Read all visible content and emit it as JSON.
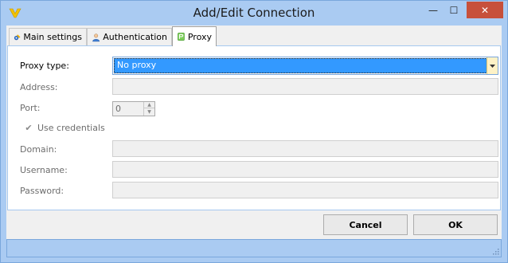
{
  "window": {
    "title": "Add/Edit Connection",
    "icon": "app-logo-icon",
    "controls": {
      "minimize": "—",
      "maximize": "☐",
      "close": "✕"
    }
  },
  "tabs": [
    {
      "label": "Main settings",
      "icon": "main-settings-icon"
    },
    {
      "label": "Authentication",
      "icon": "user-icon"
    },
    {
      "label": "Proxy",
      "icon": "proxy-icon",
      "selected": true
    }
  ],
  "form": {
    "proxy_type": {
      "label": "Proxy type:",
      "value": "No proxy"
    },
    "address": {
      "label": "Address:",
      "value": ""
    },
    "port": {
      "label": "Port:",
      "value": "0"
    },
    "use_credentials": {
      "label": "Use credentials",
      "checked": true
    },
    "domain": {
      "label": "Domain:",
      "value": ""
    },
    "username": {
      "label": "Username:",
      "value": ""
    },
    "password": {
      "label": "Password:",
      "value": ""
    }
  },
  "buttons": {
    "cancel": "Cancel",
    "ok": "OK"
  },
  "colors": {
    "titlebar": "#aacbf2",
    "close": "#c7503b",
    "selection": "#3399ff"
  }
}
